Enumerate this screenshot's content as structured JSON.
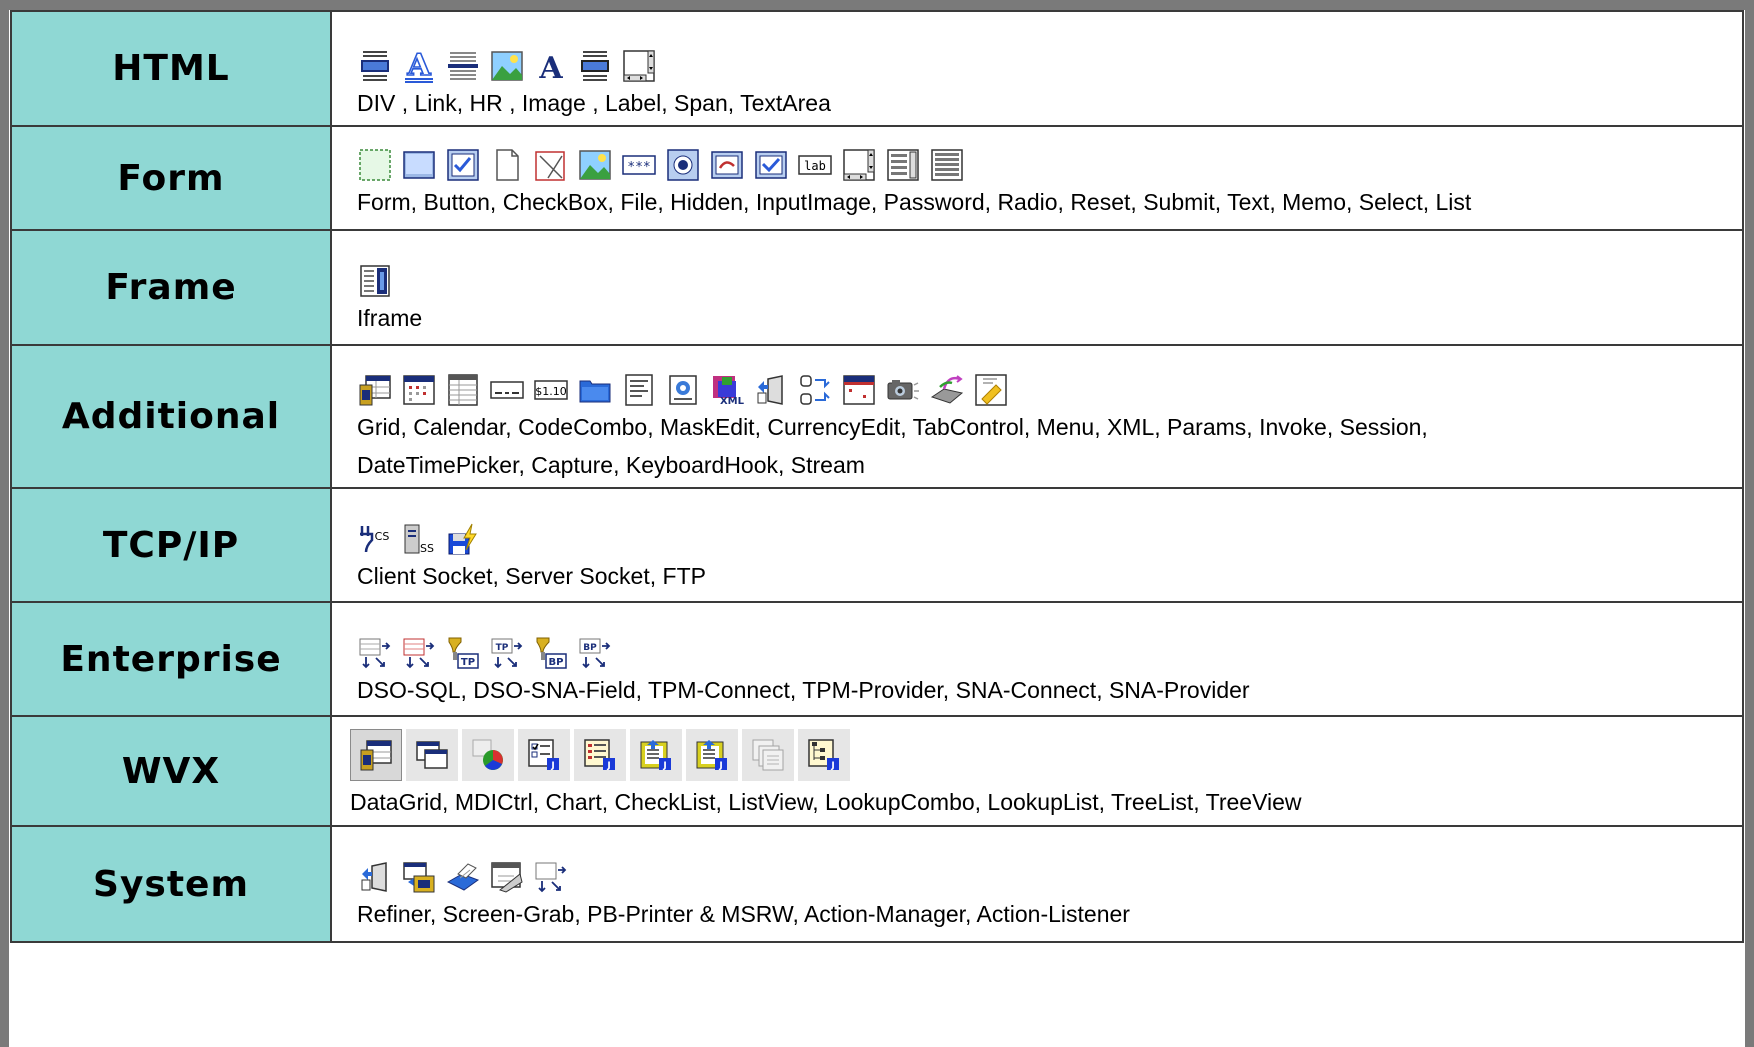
{
  "rows": [
    {
      "category": "HTML",
      "icons": [
        "div-icon",
        "link-icon",
        "hr-icon",
        "image-icon",
        "label-icon",
        "span-icon",
        "textarea-icon"
      ],
      "components": "DIV , Link, HR , Image , Label, Span, TextArea"
    },
    {
      "category": "Form",
      "icons": [
        "form-icon",
        "button-icon",
        "checkbox-icon",
        "file-icon",
        "hidden-icon",
        "input-image-icon",
        "password-icon",
        "radio-icon",
        "reset-icon",
        "submit-icon",
        "text-icon",
        "memo-icon",
        "select-icon",
        "list-icon"
      ],
      "components": "Form, Button, CheckBox, File, Hidden, InputImage, Password, Radio, Reset, Submit, Text, Memo, Select, List"
    },
    {
      "category": "Frame",
      "icons": [
        "iframe-icon"
      ],
      "components": "Iframe"
    },
    {
      "category": "Additional",
      "icons": [
        "grid-icon",
        "calendar-icon",
        "codecombo-icon",
        "maskedit-icon",
        "currencyedit-icon",
        "tabcontrol-icon",
        "menu-icon",
        "xml-icon",
        "params-icon",
        "invoke-icon",
        "session-icon",
        "datetimepicker-icon",
        "capture-icon",
        "keyboardhook-icon",
        "stream-icon"
      ],
      "components": "Grid, Calendar, CodeCombo, MaskEdit, CurrencyEdit, TabControl, Menu, XML, Params, Invoke, Session, DateTimePicker, Capture, KeyboardHook, Stream"
    },
    {
      "category": "TCP/IP",
      "icons": [
        "client-socket-icon",
        "server-socket-icon",
        "ftp-icon"
      ],
      "components": "Client Socket, Server Socket, FTP"
    },
    {
      "category": "Enterprise",
      "icons": [
        "dso-sql-icon",
        "dso-sna-field-icon",
        "tpm-connect-icon",
        "tpm-provider-icon",
        "sna-connect-icon",
        "sna-provider-icon"
      ],
      "components": "DSO-SQL, DSO-SNA-Field, TPM-Connect, TPM-Provider, SNA-Connect, SNA-Provider"
    },
    {
      "category": "WVX",
      "icons": [
        "datagrid-icon",
        "mdictrl-icon",
        "chart-icon",
        "checklist-icon",
        "listview-icon",
        "lookupcombo-icon",
        "lookuplist-icon",
        "treelist-icon",
        "treeview-icon"
      ],
      "components": "DataGrid, MDICtrl, Chart, CheckList, ListView, LookupCombo, LookupList, TreeList, TreeView"
    },
    {
      "category": "System",
      "icons": [
        "refiner-icon",
        "screen-grab-icon",
        "pb-printer-icon",
        "action-manager-icon",
        "action-listener-icon"
      ],
      "components": "Refiner, Screen-Grab, PB-Printer & MSRW, Action-Manager, Action-Listener"
    }
  ],
  "icon_glyphs": {
    "$1.10": "currencyedit-label",
    "lab": "label-text",
    "***": "password-mask",
    "XML": "xml-label",
    "CS": "client-socket-label",
    "SS": "server-socket-label",
    "TP": "tpm-label",
    "BP": "sna-label"
  },
  "colors": {
    "category_bg": "#8fd8d4",
    "border": "#3a3a3a",
    "frame": "#7a7a7a",
    "icon_blue": "#1f3fa6",
    "icon_navy": "#1a2e7a"
  }
}
